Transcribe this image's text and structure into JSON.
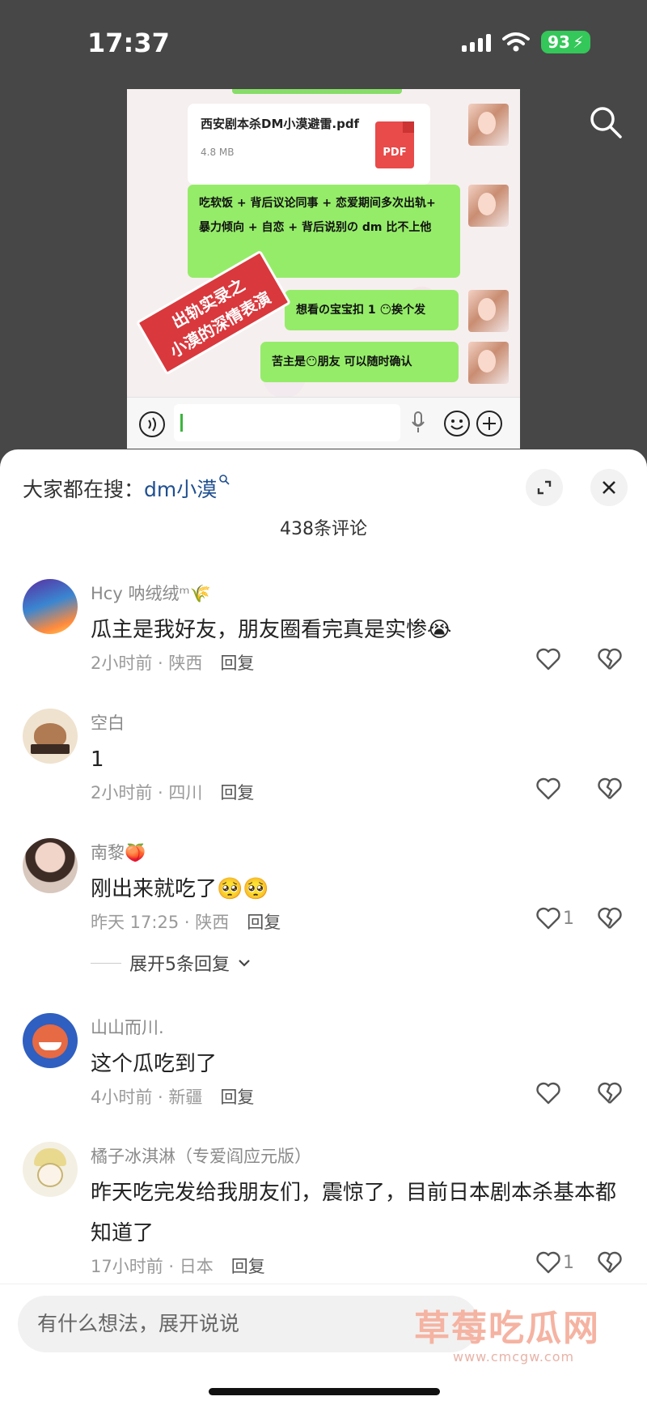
{
  "status_bar": {
    "time": "17:37",
    "battery": "93"
  },
  "shared_image": {
    "file_name": "西安剧本杀DM小漠避雷.pdf",
    "file_size": "4.8 MB",
    "file_type": "PDF",
    "messages": [
      "吃软饭 + 背后议论同事 + 恋爱期间多次出轨+ 暴力倾向 + 自恋 + 背后说别の dm 比不上他",
      "想看の宝宝扣 1 😶挨个发",
      "苦主是😶朋友  可以随时确认"
    ],
    "stamp_line1": "出轨实录之",
    "stamp_line2": "小漠的深情表演"
  },
  "sheet": {
    "trending_prefix": "大家都在搜：",
    "trending_keyword": "dm小漠",
    "comment_count": "438条评论"
  },
  "comments": [
    {
      "user": "Hcy 呐绒绒ᵐ🌾",
      "text": "瓜主是我好友，朋友圈看完真是实惨😭",
      "time": "2小时前 · 陕西",
      "reply": "回复",
      "likes": ""
    },
    {
      "user": "空白",
      "text": "1",
      "time": "2小时前 · 四川",
      "reply": "回复",
      "likes": ""
    },
    {
      "user": "南黎🍑",
      "text": "刚出来就吃了🥺🥺",
      "time": "昨天 17:25 · 陕西",
      "reply": "回复",
      "likes": "1",
      "more_replies": "展开5条回复"
    },
    {
      "user": "山山而川.",
      "text": "这个瓜吃到了",
      "time": "4小时前 · 新疆",
      "reply": "回复",
      "likes": ""
    },
    {
      "user": "橘子冰淇淋（专爱阎应元版）",
      "text": "昨天吃完发给我朋友们，震惊了，目前日本剧本杀基本都知道了",
      "time": "17小时前 · 日本",
      "reply": "回复",
      "likes": "1"
    }
  ],
  "input": {
    "placeholder": "有什么想法，展开说说"
  },
  "watermark": {
    "text": "草莓吃瓜网",
    "url": "www.cmcgw.com"
  }
}
